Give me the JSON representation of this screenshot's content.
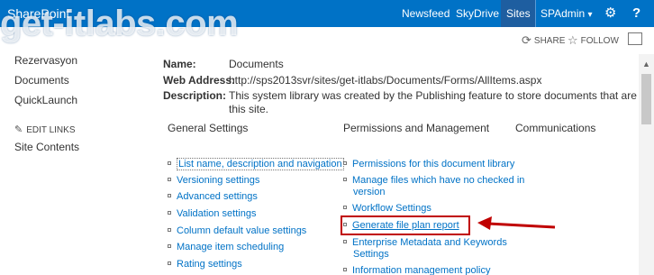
{
  "suite_bar": {
    "brand": "SharePoint",
    "watermark": "get-itlabs.com",
    "links": [
      "Newsfeed",
      "SkyDrive",
      "Sites"
    ],
    "active_link": "Sites",
    "user": "SPAdmin",
    "user_caret": "▾",
    "colors": {
      "bar": "#0072c6",
      "active": "#1e5ea0"
    }
  },
  "actions": {
    "share": "SHARE",
    "follow": "FOLLOW"
  },
  "left_nav": {
    "items": [
      "Rezervasyon",
      "Documents",
      "QuickLaunch"
    ],
    "edit_links": "EDIT LINKS",
    "site_contents": "Site Contents"
  },
  "properties": {
    "name_label": "Name:",
    "name_value": "Documents",
    "web_address_label": "Web Address:",
    "web_address_value": "http://sps2013svr/sites/get-itlabs/Documents/Forms/AllItems.aspx",
    "description_label": "Description:",
    "description_line1": "This system library was created by the Publishing feature to store documents that are used on pa",
    "description_line2": "this site."
  },
  "sections": {
    "general": {
      "title": "General Settings",
      "links": [
        "List name, description and navigation",
        "Versioning settings",
        "Advanced settings",
        "Validation settings",
        "Column default value settings",
        "Manage item scheduling",
        "Rating settings"
      ]
    },
    "permissions": {
      "title": "Permissions and Management",
      "links": {
        "permissions": "Permissions for this document library",
        "manage_line1": "Manage files which have no checked in",
        "manage_line2": "version",
        "workflow": "Workflow Settings",
        "file_plan": "Generate file plan report",
        "metadata_line1": "Enterprise Metadata and Keywords",
        "metadata_line2": "Settings",
        "info_policy": "Information management policy"
      }
    },
    "communications": {
      "title": "Communications"
    }
  },
  "annotation": {
    "highlight_color": "#c00000"
  }
}
